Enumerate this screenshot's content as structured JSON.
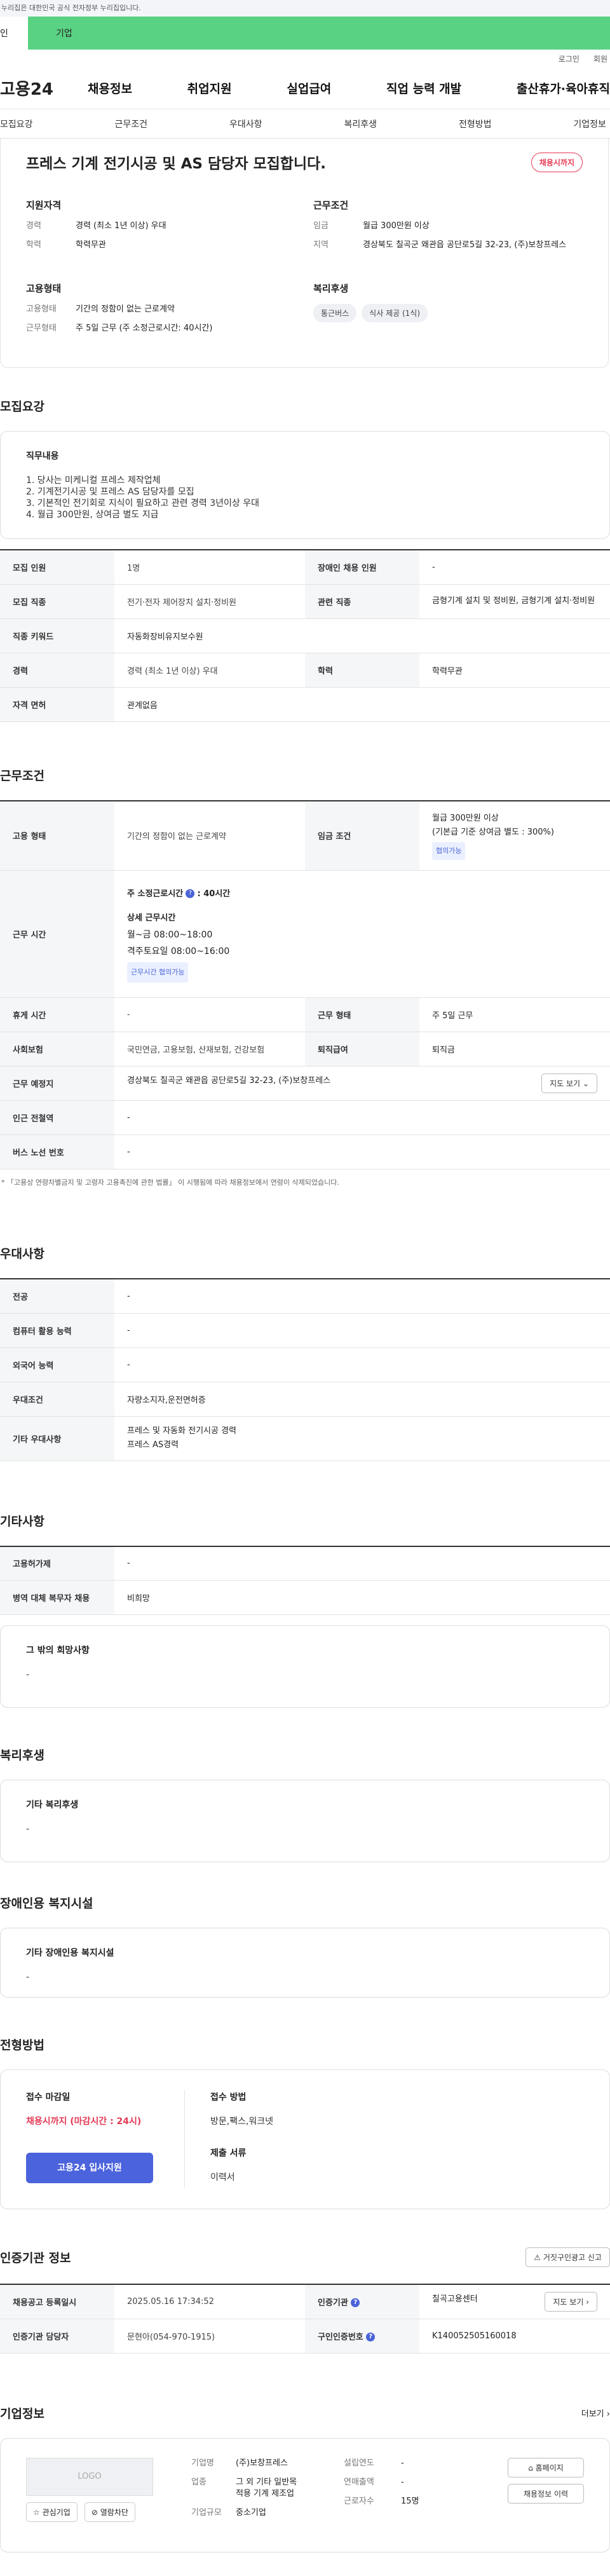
{
  "gov": {
    "notice": "누리집은 대한민국 공식 전자정부 누리집입니다."
  },
  "gtabs": {
    "t1": "인",
    "t2": "기업"
  },
  "util": {
    "login": "로그인",
    "join": "회원"
  },
  "gnb": {
    "logo": "고용24",
    "m1": "채용정보",
    "m2": "취업지원",
    "m3": "실업급여",
    "m4": "직업 능력 개발",
    "m5": "출산휴가·육아휴직"
  },
  "snb": {
    "s1": "모집요강",
    "s2": "근무조건",
    "s3": "우대사항",
    "s4": "복리후생",
    "s5": "전형방법",
    "s6": "기업정보"
  },
  "top": {
    "title": "프레스 기계 전기시공 및 AS 담당자 모집합니다.",
    "badge": "채용시까지",
    "qual_h": "지원자격",
    "career_k": "경력",
    "career_v": "경력 (최소 1년 이상) 우대",
    "edu_k": "학력",
    "edu_v": "학력무관",
    "cond_h": "근무조건",
    "wage_k": "임금",
    "wage_v": "월급 300만원 이상",
    "area_k": "지역",
    "area_v": "경상북도 칠곡군 왜관읍 공단로5길 32-23, (주)보창프레스",
    "emp_h": "고용형태",
    "emptype_k": "고용형태",
    "emptype_v": "기간의 정함이 없는 근로계약",
    "worktype_k": "근무형태",
    "worktype_v": "주 5일 근무 (주 소정근로시간: 40시간)",
    "wel_h": "복리후생",
    "chip1": "통근버스",
    "chip2": "식사 제공 (1식)"
  },
  "recruit": {
    "title": "모집요강",
    "job_h": "직무내용",
    "lines": [
      "1. 당사는 미케니컬 프레스 제작업체",
      "2. 기계전기시공 및 프레스 AS 담당자를  모집",
      "3. 기본적인 전기회로 지식이 필요하고 관련 경력 3년이상 우대",
      "4. 월급 300만원, 상여금 별도 지급"
    ],
    "r1a": "모집 인원",
    "r1b": "1명",
    "r1c": "장애인 채용 인원",
    "r1d": "-",
    "r2a": "모집 직종",
    "r2b": "전기·전자 제어장치 설치·정비원",
    "r2c": "관련 직종",
    "r2d": "금형기계 설치 및 정비원, 금형기계 설치·정비원",
    "r3a": "직종 키워드",
    "r3b": "자동화장비유지보수원",
    "r4a": "경력",
    "r4b": "경력 (최소 1년 이상) 우대",
    "r4c": "학력",
    "r4d": "학력무관",
    "r5a": "자격 면허",
    "r5b": "관계없음"
  },
  "work": {
    "title": "근무조건",
    "w1a": "고용 형태",
    "w1b": "기간의 정함이 없는 근로계약",
    "w1c": "임금 조건",
    "w1d1": "월급 300만원 이상",
    "w1d2": "(기본급 기준 상여금 별도 : 300%)",
    "w1d3": "협의가능",
    "w2a": "근무 시간",
    "w2b1": "주 소정근로시간",
    "w2b2": ": 40시간",
    "w2b3": "상세 근무시간",
    "w2b4": "월~금 08:00~18:00",
    "w2b5": "격주토요일 08:00~16:00",
    "w2b6": "근무시간 협의가능",
    "w3a": "휴게 시간",
    "w3b": "-",
    "w3c": "근무 형태",
    "w3d": "주 5일 근무",
    "w4a": "사회보험",
    "w4b": "국민연금, 고용보험, 산재보험, 건강보험",
    "w4c": "퇴직급여",
    "w4d": "퇴직금",
    "w5a": "근무 예정지",
    "w5b": "경상북도 칠곡군 왜관읍 공단로5길 32-23, (주)보창프레스",
    "w5btn": "지도 보기",
    "w6a": "인근 전철역",
    "w6b": "-",
    "w7a": "버스 노선 번호",
    "w7b": "-",
    "note": "「고용상 연령차별금지 및 고령자 고용촉진에 관한 법률」 이 시행됨에 따라 채용정보에서 연령이 삭제되었습니다."
  },
  "pref": {
    "title": "우대사항",
    "p1a": "전공",
    "p1b": "-",
    "p2a": "컴퓨터 활용 능력",
    "p2b": "-",
    "p3a": "외국어 능력",
    "p3b": "-",
    "p4a": "우대조건",
    "p4b": "자량소지자,운전면허증",
    "p5a": "기타 우대사항",
    "p5b1": "프레스 및 자동화 전기시공 경력",
    "p5b2": "프레스 AS경력"
  },
  "etc": {
    "title": "기타사항",
    "e1a": "고용허가제",
    "e1b": "-",
    "e2a": "병역 대체 복무자 채용",
    "e2b": "비희망",
    "box_h": "그 밖의 희망사항",
    "box_v": "-"
  },
  "welfare": {
    "title": "복리후생",
    "h": "기타 복리후생",
    "v": "-"
  },
  "disab": {
    "title": "장애인용 복지시설",
    "h": "기타 장애인용 복지시설",
    "v": "-"
  },
  "apply": {
    "title": "전형방법",
    "deadline_h": "접수 마감일",
    "deadline_v": "채용시까지 (마감시간 : 24시)",
    "btn": "고용24 입사지원",
    "method_h": "접수 방법",
    "method_v": "방문,팩스,워크넷",
    "doc_h": "제출 서류",
    "doc_v": "이력서"
  },
  "cert": {
    "title": "인증기관 정보",
    "report": "거짓구인광고 신고",
    "c1a": "채용공고 등록일시",
    "c1b": "2025.05.16 17:34:52",
    "c1c": "인증기관",
    "c1d": "칠곡고용센터",
    "c1btn": "지도 보기",
    "c2a": "인증기관 담당자",
    "c2b": "문현아(054-970-1915)",
    "c2c": "구인인증번호",
    "c2d": "K140052505160018"
  },
  "company": {
    "title": "기업정보",
    "more": "더보기",
    "logo": "LOGO",
    "fav": "관심기업",
    "block": "열람차단",
    "k1": "기업명",
    "v1": "(주)보창프레스",
    "k2": "업종",
    "v2a": "그 외 기타 일반목",
    "v2b": "적용 기계 제조업",
    "k3": "기업규모",
    "v3": "중소기업",
    "k4": "설립연도",
    "v4": "-",
    "k5": "연매출액",
    "v5": "-",
    "k6": "근로자수",
    "v6": "15명",
    "b1": "홈페이지",
    "b2": "채용정보 이력"
  }
}
